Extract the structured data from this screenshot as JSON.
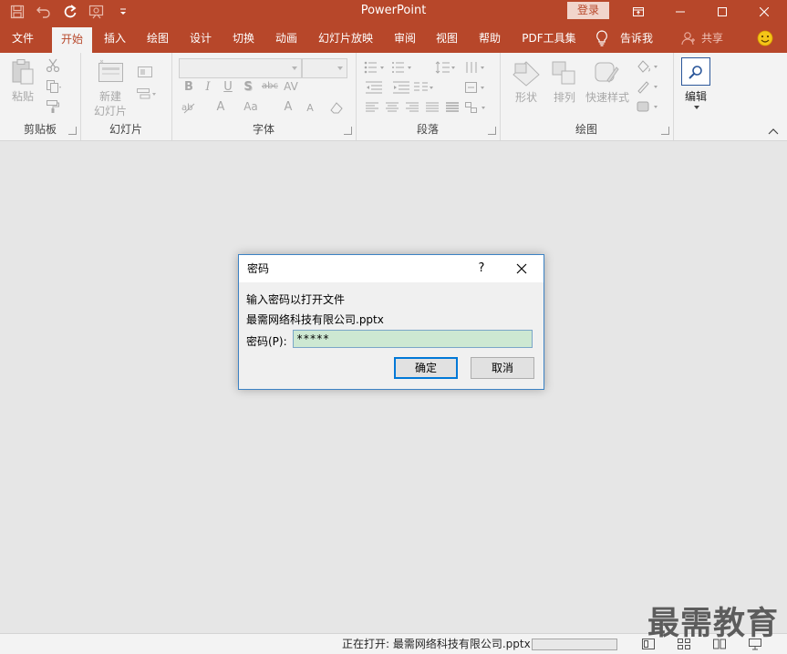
{
  "titlebar": {
    "app_title": "PowerPoint",
    "login_label": "登录",
    "qat_icons": [
      "save-icon",
      "undo-icon",
      "redo-icon",
      "slideshow-from-start-icon",
      "customize-qat-icon"
    ],
    "window_controls": [
      "ribbon-display-options-icon",
      "minimize-icon",
      "maximize-icon",
      "close-icon"
    ]
  },
  "tabs": [
    {
      "label": "文件",
      "active": false
    },
    {
      "label": "开始",
      "active": true
    },
    {
      "label": "插入",
      "active": false
    },
    {
      "label": "绘图",
      "active": false
    },
    {
      "label": "设计",
      "active": false
    },
    {
      "label": "切换",
      "active": false
    },
    {
      "label": "动画",
      "active": false
    },
    {
      "label": "幻灯片放映",
      "active": false
    },
    {
      "label": "审阅",
      "active": false
    },
    {
      "label": "视图",
      "active": false
    },
    {
      "label": "帮助",
      "active": false
    },
    {
      "label": "PDF工具集",
      "active": false
    }
  ],
  "tell_me": "告诉我",
  "share": "共享",
  "ribbon": {
    "clipboard": {
      "label": "剪贴板",
      "paste": "粘贴"
    },
    "slides": {
      "label": "幻灯片",
      "new_slide_line1": "新建",
      "new_slide_line2": "幻灯片"
    },
    "font": {
      "label": "字体",
      "bold": "B",
      "italic": "I",
      "underline": "U",
      "shadow": "S",
      "strike": "abc",
      "spacing": "AV",
      "font_color": "A",
      "change_case": "Aa",
      "grow": "A",
      "shrink": "A"
    },
    "paragraph": {
      "label": "段落"
    },
    "drawing": {
      "label": "绘图",
      "shapes": "形状",
      "arrange": "排列",
      "quick_styles": "快速样式"
    },
    "editing": {
      "label": "编辑"
    }
  },
  "dialog": {
    "title": "密码",
    "help": "?",
    "message": "输入密码以打开文件",
    "filename": "最需网络科技有限公司.pptx",
    "password_label": "密码(P):",
    "password_value": "*****",
    "ok_label": "确定",
    "cancel_label": "取消"
  },
  "statusbar": {
    "status_text": "正在打开: 最需网络科技有限公司.pptx",
    "progress": 0.0,
    "view_icons": [
      "normal-view-icon",
      "slide-sorter-icon",
      "reading-view-icon",
      "slideshow-view-icon"
    ]
  },
  "watermark": "最需教育",
  "colors": {
    "accent": "#b7472a",
    "dialog_border": "#3c82c4",
    "input_bg": "#cde8d2",
    "default_button": "#0078d7"
  }
}
